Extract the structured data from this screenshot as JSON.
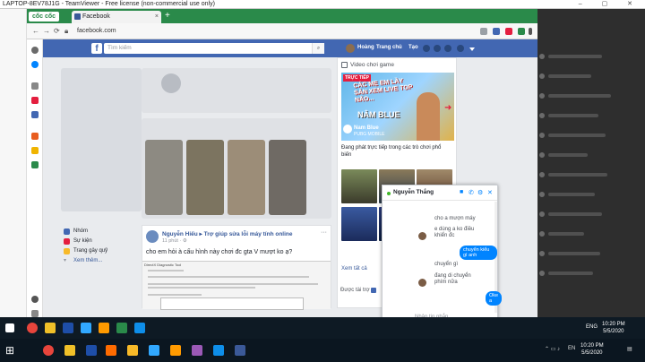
{
  "window": {
    "title": "LAPTOP-8EV78J1G - TeamViewer - Free license (non-commercial use only)",
    "controls": "– ▢ ✕"
  },
  "browser": {
    "brand": "cốc cốc",
    "tab_title": "Facebook",
    "tab_close": "×",
    "new_tab": "+",
    "url": "facebook.com"
  },
  "facebook": {
    "logo": "f",
    "search_placeholder": "Tìm kiếm",
    "user_name": "Hoàng",
    "nav_home": "Trang chủ",
    "nav_create": "Tạo"
  },
  "left_nav": [
    {
      "label": "Nhóm",
      "color": "#4267b2"
    },
    {
      "label": "Sự kiện",
      "color": "#e41e3f"
    },
    {
      "label": "Trang gây quỹ",
      "color": "#f7b928"
    },
    {
      "label": "Xem thêm...",
      "color": "#90949c"
    }
  ],
  "post": {
    "author": "Nguyễn Hiếu ▸ Trợ giúp sửa lỗi máy tính online",
    "time": "11 phút · ⚙",
    "more": "···",
    "text": "cho em hỏi à cấu hình này chơi đc gta V mượt ko ạ?",
    "screenshot_title": "DirectX Diagnostic Tool"
  },
  "video_panel": {
    "title": "Video chơi game",
    "live_badge": "TRỰC TIẾP",
    "overlay_1": "CÁC MẸ EM LẦY SẴN XEM LIVE TOP NÃO...",
    "overlay_2": "NÂM BLUE",
    "channel": "Nam Blue",
    "channel_sub": "PUBG MOBILE",
    "description": "Đang phát trực tiếp trong các trò chơi phổ biến",
    "see_all": "Xem tất cả",
    "downloaded": "Được tài trợ"
  },
  "chat": {
    "name": "Nguyễn Thắng",
    "messages": [
      {
        "dir": "in",
        "text": "cho a mượn máy"
      },
      {
        "dir": "in",
        "text": "e dùng a ko điều khiển đc"
      },
      {
        "dir": "out",
        "text": "chuyển kiểu gì anh"
      },
      {
        "dir": "in",
        "text": "chuyển gì"
      },
      {
        "dir": "in",
        "text": "đang di chuyển phím nữa"
      },
      {
        "dir": "out",
        "text": "Oke a"
      }
    ],
    "input_placeholder": "Nhập tin nhắn..."
  },
  "remote_taskbar": {
    "lang": "ENG",
    "time": "10:20 PM",
    "date": "5/5/2020"
  },
  "taskbar": {
    "lang": "EN",
    "time": "10:20 PM",
    "date": "5/5/2020"
  }
}
